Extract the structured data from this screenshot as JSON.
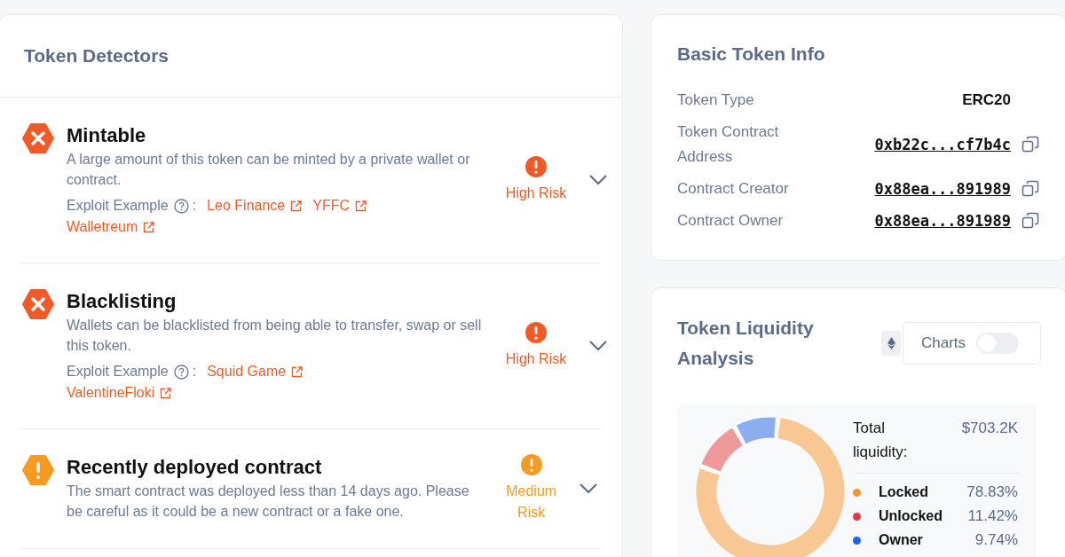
{
  "detectors": {
    "title": "Token Detectors",
    "items": [
      {
        "kind": "high",
        "title": "Mintable",
        "description": "A large amount of this token can be minted by a private wallet or contract.",
        "exploit_label": "Exploit Example",
        "exploit_separator": ":",
        "exploits": [
          "Leo Finance",
          "YFFC",
          "Walletreum"
        ],
        "risk": "High Risk",
        "expanded": false
      },
      {
        "kind": "high",
        "title": "Blacklisting",
        "description": "Wallets can be blacklisted from being able to transfer, swap or sell this token.",
        "exploit_label": "Exploit Example",
        "exploit_separator": ":",
        "exploits": [
          "Squid Game",
          "ValentineFloki"
        ],
        "risk": "High Risk",
        "expanded": false
      },
      {
        "kind": "medium",
        "title": "Recently deployed contract",
        "description": "The smart contract was deployed less than 14 days ago. Please be careful as it could be a new contract or a fake one.",
        "risk": "Medium Risk",
        "expanded": false
      }
    ]
  },
  "basic_info": {
    "title": "Basic Token Info",
    "rows": [
      {
        "label": "Token Type",
        "value": "ERC20",
        "kind": "plain"
      },
      {
        "label": "Token Contract Address",
        "value": "0xb22c...cf7b4c",
        "kind": "address"
      },
      {
        "label": "Contract Creator",
        "value": "0x88ea...891989",
        "kind": "address"
      },
      {
        "label": "Contract Owner",
        "value": "0x88ea...891989",
        "kind": "address"
      }
    ]
  },
  "liquidity": {
    "title": "Token Liquidity Analysis",
    "charts_toggle": {
      "label": "Charts",
      "on": false
    },
    "total_label": "Total liquidity:",
    "total_value": "$703.2K",
    "legend": [
      {
        "name": "Locked",
        "share": "78.83%",
        "color": "#f7952d"
      },
      {
        "name": "Unlocked",
        "share": "11.42%",
        "color": "#e5393f"
      },
      {
        "name": "Owner",
        "share": "9.74%",
        "color": "#1f63e8"
      }
    ]
  }
}
